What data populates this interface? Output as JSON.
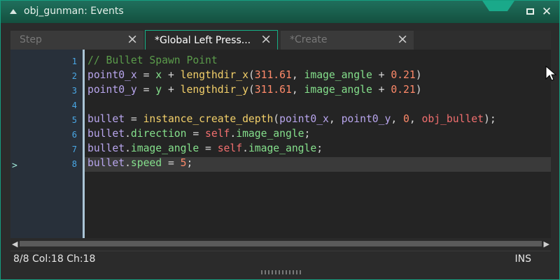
{
  "window": {
    "title": "obj_gunman: Events"
  },
  "tabs": [
    {
      "label": "Step"
    },
    {
      "label": "*Global Left Press..."
    },
    {
      "label": "*Create"
    }
  ],
  "editor": {
    "line_numbers": [
      "1",
      "2",
      "3",
      "4",
      "5",
      "6",
      "7",
      "8"
    ],
    "code": [
      "// Bullet Spawn Point",
      "point0_x = x + lengthdir_x(311.61, image_angle + 0.21)",
      "point0_y = y + lengthdir_y(311.61, image_angle + 0.21)",
      "",
      "bullet = instance_create_depth(point0_x, point0_y, 0, obj_bullet);",
      "bullet.direction = self.image_angle;",
      "bullet.image_angle = self.image_angle;",
      "bullet.speed = 5;"
    ]
  },
  "status": {
    "position": "8/8 Col:18 Ch:18",
    "mode": "INS"
  },
  "colors": {
    "accent": "#15b086",
    "title_bar": "#1f6f5c"
  }
}
